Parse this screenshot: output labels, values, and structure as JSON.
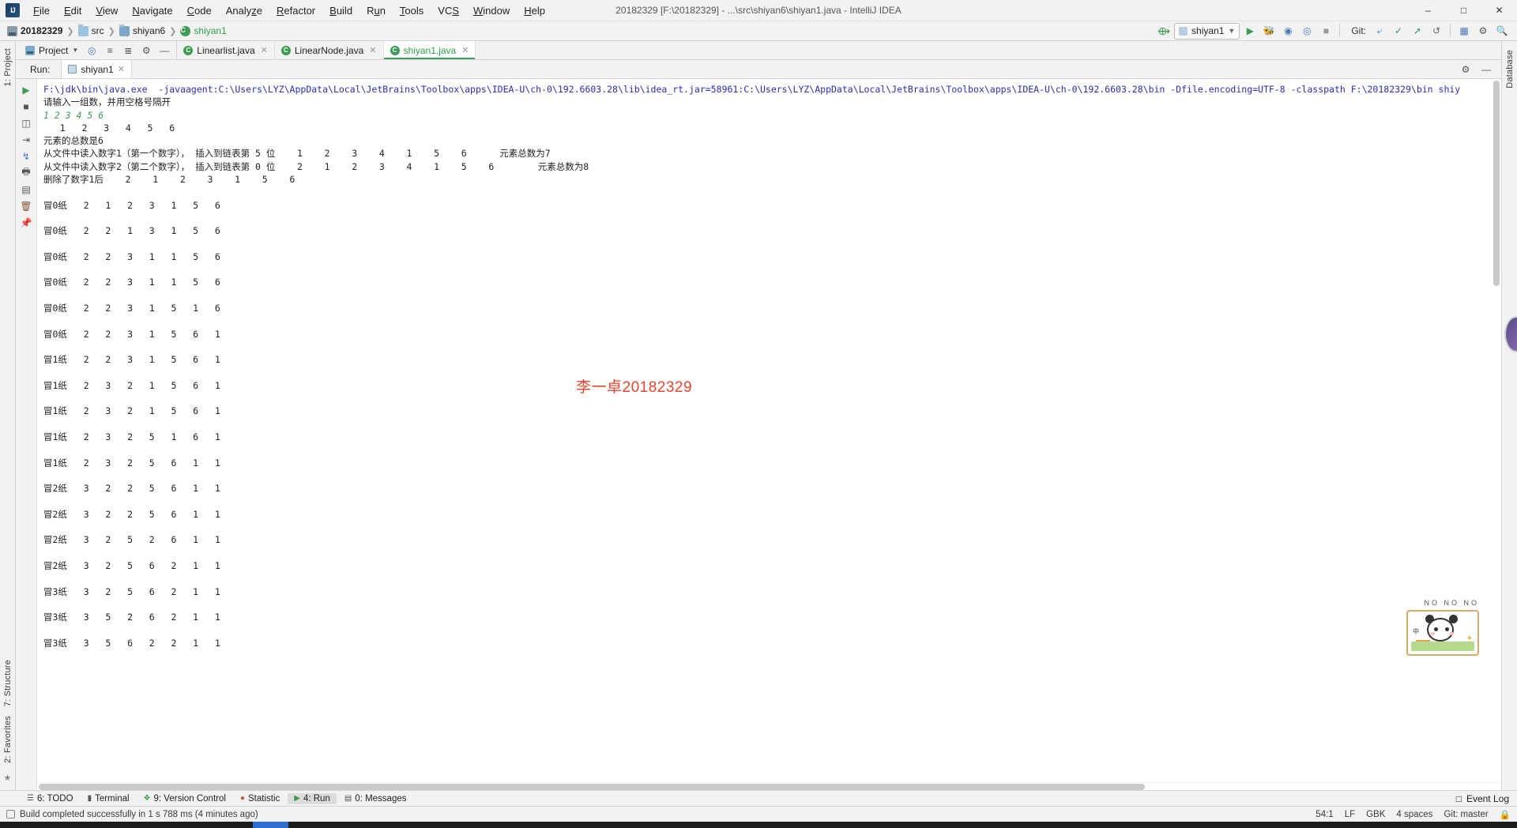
{
  "window": {
    "title": "20182329 [F:\\20182329] - ...\\src\\shiyan6\\shiyan1.java - IntelliJ IDEA",
    "minimize": "–",
    "maximize": "□",
    "close": "✕"
  },
  "menu": [
    {
      "label": "File"
    },
    {
      "label": "Edit"
    },
    {
      "label": "View"
    },
    {
      "label": "Navigate"
    },
    {
      "label": "Code"
    },
    {
      "label": "Analyze"
    },
    {
      "label": "Refactor"
    },
    {
      "label": "Build"
    },
    {
      "label": "Run"
    },
    {
      "label": "Tools"
    },
    {
      "label": "VCS"
    },
    {
      "label": "Window"
    },
    {
      "label": "Help"
    }
  ],
  "breadcrumbs": [
    {
      "label": "20182329",
      "icon": "module-icon"
    },
    {
      "label": "src",
      "icon": "folder-icon"
    },
    {
      "label": "shiyan6",
      "icon": "folder-icon"
    },
    {
      "label": "shiyan1",
      "icon": "class-icon"
    }
  ],
  "toolbar": {
    "run_config": "shiyan1",
    "git_label": "Git:",
    "icons": [
      "hammer-icon",
      "run-icon",
      "debug-icon",
      "coverage-icon",
      "profile-icon",
      "stop-icon",
      "git-update-icon",
      "git-commit-icon",
      "git-push-icon",
      "git-revert-icon",
      "layout-icon",
      "settings-icon",
      "search-icon"
    ]
  },
  "project_panel": {
    "title": "Project",
    "icons": [
      "locate-icon",
      "expand-icon",
      "collapse-icon",
      "gear-icon",
      "hide-icon"
    ]
  },
  "editor_tabs": [
    {
      "label": "Linearlist.java",
      "active": false
    },
    {
      "label": "LinearNode.java",
      "active": false
    },
    {
      "label": "shiyan1.java",
      "active": true
    }
  ],
  "left_strips": [
    {
      "label": "1: Project"
    },
    {
      "label": "7: Structure"
    },
    {
      "label": "2: Favorites"
    }
  ],
  "right_strips": [
    {
      "label": "Database"
    }
  ],
  "run_window": {
    "title": "Run:",
    "tab": "shiyan1",
    "gutter_icons": [
      "rerun-icon",
      "stop-icon",
      "up-icon",
      "down-icon",
      "soft-wrap-icon",
      "scroll-end-icon",
      "print-icon",
      "export-icon",
      "clear-icon",
      "pin-icon"
    ],
    "header_icons": [
      "settings-icon",
      "minimize-icon"
    ]
  },
  "console": {
    "command": "F:\\jdk\\bin\\java.exe  -javaagent:C:\\Users\\LYZ\\AppData\\Local\\JetBrains\\Toolbox\\apps\\IDEA-U\\ch-0\\192.6603.28\\lib\\idea_rt.jar=58961:C:\\Users\\LYZ\\AppData\\Local\\JetBrains\\Toolbox\\apps\\IDEA-U\\ch-0\\192.6603.28\\bin -Dfile.encoding=UTF-8 -classpath F:\\20182329\\bin shiy",
    "prompt": "请输入一组数，并用空格号隔开",
    "user_input": "1 2 3 4 5 6",
    "echo_list": "   1   2   3   4   5   6",
    "total_count": "元素的总数是6",
    "insert1": "从文件中读入数字1（第一个数字）， 插入到链表第 5 位    1    2    3    4    1    5    6      元素总数为7",
    "insert2": "从文件中读入数字2（第二个数字）， 插入到链表第 0 位    2    1    2    3    4    1    5    6        元素总数为8",
    "deleted": "删除了数字1后    2    1    2    3    1    5    6",
    "sort_rows": [
      {
        "label": "冒0纸",
        "values": [
          "2",
          "1",
          "2",
          "3",
          "1",
          "5",
          "6"
        ]
      },
      {
        "label": "冒0纸",
        "values": [
          "2",
          "2",
          "1",
          "3",
          "1",
          "5",
          "6"
        ]
      },
      {
        "label": "冒0纸",
        "values": [
          "2",
          "2",
          "3",
          "1",
          "1",
          "5",
          "6"
        ]
      },
      {
        "label": "冒0纸",
        "values": [
          "2",
          "2",
          "3",
          "1",
          "1",
          "5",
          "6"
        ]
      },
      {
        "label": "冒0纸",
        "values": [
          "2",
          "2",
          "3",
          "1",
          "5",
          "1",
          "6"
        ]
      },
      {
        "label": "冒0纸",
        "values": [
          "2",
          "2",
          "3",
          "1",
          "5",
          "6",
          "1"
        ]
      },
      {
        "label": "冒1纸",
        "values": [
          "2",
          "2",
          "3",
          "1",
          "5",
          "6",
          "1"
        ]
      },
      {
        "label": "冒1纸",
        "values": [
          "2",
          "3",
          "2",
          "1",
          "5",
          "6",
          "1"
        ]
      },
      {
        "label": "冒1纸",
        "values": [
          "2",
          "3",
          "2",
          "1",
          "5",
          "6",
          "1"
        ]
      },
      {
        "label": "冒1纸",
        "values": [
          "2",
          "3",
          "2",
          "5",
          "1",
          "6",
          "1"
        ]
      },
      {
        "label": "冒1纸",
        "values": [
          "2",
          "3",
          "2",
          "5",
          "6",
          "1",
          "1"
        ]
      },
      {
        "label": "冒2纸",
        "values": [
          "3",
          "2",
          "2",
          "5",
          "6",
          "1",
          "1"
        ]
      },
      {
        "label": "冒2纸",
        "values": [
          "3",
          "2",
          "2",
          "5",
          "6",
          "1",
          "1"
        ]
      },
      {
        "label": "冒2纸",
        "values": [
          "3",
          "2",
          "5",
          "2",
          "6",
          "1",
          "1"
        ]
      },
      {
        "label": "冒2纸",
        "values": [
          "3",
          "2",
          "5",
          "6",
          "2",
          "1",
          "1"
        ]
      },
      {
        "label": "冒3纸",
        "values": [
          "3",
          "2",
          "5",
          "6",
          "2",
          "1",
          "1"
        ]
      },
      {
        "label": "冒3纸",
        "values": [
          "3",
          "5",
          "2",
          "6",
          "2",
          "1",
          "1"
        ]
      },
      {
        "label": "冒3纸",
        "values": [
          "3",
          "5",
          "6",
          "2",
          "2",
          "1",
          "1"
        ]
      }
    ],
    "watermark": "李一卓20182329"
  },
  "sticker": {
    "caption": "NO NO NO",
    "cn_char": "中"
  },
  "bottom_tabs": [
    {
      "label": "6: TODO",
      "icon": "todo-icon",
      "active": false
    },
    {
      "label": "Terminal",
      "icon": "terminal-icon",
      "active": false
    },
    {
      "label": "9: Version Control",
      "icon": "vcs-icon",
      "active": false
    },
    {
      "label": "Statistic",
      "icon": "statistic-icon",
      "active": false
    },
    {
      "label": "4: Run",
      "icon": "run-icon",
      "active": true
    },
    {
      "label": "0: Messages",
      "icon": "messages-icon",
      "active": false
    }
  ],
  "bottom_right": {
    "event_log": "Event Log"
  },
  "status_bar": {
    "message": "Build completed successfully in 1 s 788 ms (4 minutes ago)",
    "caret": "54:1",
    "line_sep": "LF",
    "encoding": "GBK",
    "indent": "4 spaces",
    "branch": "Git: master"
  }
}
